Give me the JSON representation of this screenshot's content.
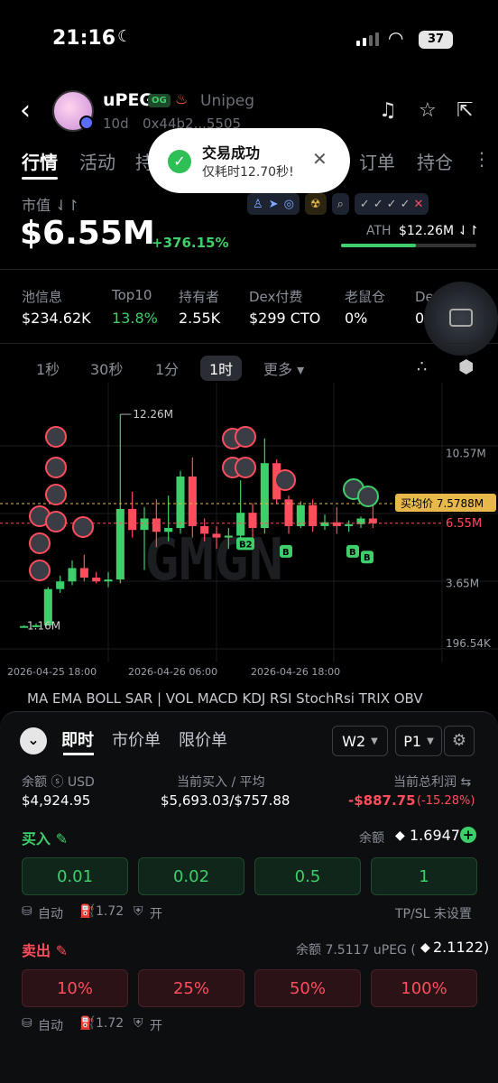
{
  "status_bar": {
    "time": "21:16",
    "battery": "37"
  },
  "header": {
    "token_name": "uPEG",
    "og_badge": "OG",
    "token_full": "Unipeg",
    "age": "10d",
    "address": "0x44b2...5505"
  },
  "tabs": [
    "行情",
    "活动",
    "持",
    "订单",
    "持仓"
  ],
  "toast": {
    "title": "交易成功",
    "subtitle": "仅耗时12.70秒!"
  },
  "market": {
    "label": "市值 ⇃↾",
    "value": "$6.55M",
    "change": "+376.15%",
    "ath_label": "ATH",
    "ath_value": "$12.26M ⇃↾",
    "ath_fraction": 0.55
  },
  "stats": [
    {
      "label": "池信息",
      "value": "$234.62K",
      "color": "#ffffff"
    },
    {
      "label": "Top10",
      "value": "13.8%",
      "color": "#3ecf6a"
    },
    {
      "label": "持有者",
      "value": "2.55K",
      "color": "#ffffff"
    },
    {
      "label": "Dex付费",
      "value": "$299 CTO",
      "color": "#ffffff"
    },
    {
      "label": "老鼠仓",
      "value": "0%",
      "color": "#ffffff"
    },
    {
      "label": "Dev持仓",
      "value": "0%",
      "color": "#ffffff"
    }
  ],
  "timeframes": [
    "1秒",
    "30秒",
    "1分",
    "1时",
    "更多 ▾"
  ],
  "chart_data": {
    "type": "candlestick",
    "y_tick_labels": [
      "10.57M",
      "6.55M",
      "3.65M",
      "196.54K"
    ],
    "high_label": "12.26M",
    "low_label": "1.16M",
    "avg_price_label": "买均价 7.5788M",
    "current_label": "6.55M",
    "x_tick_labels": [
      "2026-04-25 18:00",
      "2026-04-26 06:00",
      "2026-04-26 18:00"
    ],
    "watermark": "GMGN",
    "trade_markers": [
      "B2",
      "B",
      "B",
      "B"
    ],
    "candles": [
      {
        "o": 1.16,
        "h": 1.2,
        "l": 1.1,
        "c": 1.16
      },
      {
        "o": 1.16,
        "h": 1.3,
        "l": 1.1,
        "c": 1.2
      },
      {
        "o": 1.2,
        "h": 3.2,
        "l": 1.2,
        "c": 3.1
      },
      {
        "o": 3.1,
        "h": 3.8,
        "l": 2.9,
        "c": 3.5
      },
      {
        "o": 3.5,
        "h": 4.6,
        "l": 3.3,
        "c": 4.2
      },
      {
        "o": 4.2,
        "h": 4.9,
        "l": 3.5,
        "c": 3.7
      },
      {
        "o": 3.7,
        "h": 4.0,
        "l": 3.4,
        "c": 3.5
      },
      {
        "o": 3.5,
        "h": 4.0,
        "l": 3.2,
        "c": 3.6
      },
      {
        "o": 3.6,
        "h": 12.26,
        "l": 3.4,
        "c": 7.3
      },
      {
        "o": 7.3,
        "h": 8.2,
        "l": 5.8,
        "c": 6.2
      },
      {
        "o": 6.2,
        "h": 7.4,
        "l": 4.1,
        "c": 6.8
      },
      {
        "o": 6.8,
        "h": 7.8,
        "l": 5.3,
        "c": 6.1
      },
      {
        "o": 6.1,
        "h": 8.0,
        "l": 5.6,
        "c": 6.3
      },
      {
        "o": 6.3,
        "h": 9.3,
        "l": 6.0,
        "c": 9.0
      },
      {
        "o": 9.0,
        "h": 10.0,
        "l": 5.8,
        "c": 6.4
      },
      {
        "o": 6.4,
        "h": 6.8,
        "l": 5.6,
        "c": 6.0
      },
      {
        "o": 6.0,
        "h": 6.4,
        "l": 5.2,
        "c": 5.8
      },
      {
        "o": 5.8,
        "h": 6.3,
        "l": 5.2,
        "c": 5.9
      },
      {
        "o": 5.9,
        "h": 8.8,
        "l": 5.6,
        "c": 7.1
      },
      {
        "o": 7.1,
        "h": 7.6,
        "l": 5.8,
        "c": 6.3
      },
      {
        "o": 6.3,
        "h": 11.0,
        "l": 6.0,
        "c": 9.7
      },
      {
        "o": 9.7,
        "h": 9.9,
        "l": 7.6,
        "c": 7.8
      },
      {
        "o": 7.8,
        "h": 8.0,
        "l": 6.0,
        "c": 6.4
      },
      {
        "o": 6.4,
        "h": 7.7,
        "l": 6.3,
        "c": 7.5
      },
      {
        "o": 7.5,
        "h": 7.8,
        "l": 6.1,
        "c": 6.4
      },
      {
        "o": 6.4,
        "h": 7.0,
        "l": 6.2,
        "c": 6.6
      },
      {
        "o": 6.6,
        "h": 7.4,
        "l": 6.0,
        "c": 6.4
      },
      {
        "o": 6.4,
        "h": 6.7,
        "l": 6.1,
        "c": 6.5
      },
      {
        "o": 6.5,
        "h": 6.9,
        "l": 6.3,
        "c": 6.8
      },
      {
        "o": 6.8,
        "h": 7.5,
        "l": 6.3,
        "c": 6.55
      }
    ]
  },
  "indicators": "MA  EMA  BOLL  SAR  |  VOL  MACD  KDJ  RSI  StochRsi  TRIX  OBV",
  "panel": {
    "tabs": [
      "即时",
      "市价单",
      "限价单"
    ],
    "wallet": "W2",
    "preset": "P1",
    "balance_label": "余额 ⓢ USD",
    "balance_value": "$4,924.95",
    "bought_label": "当前买入 / 平均",
    "bought_value": "$5,693.03/$757.88",
    "pnl_label": "当前总利润 ⇆",
    "pnl_value": "-$887.75",
    "pnl_pct": "(-15.28%)",
    "buy": {
      "title": "买入 ✎",
      "balance_label": "余额",
      "balance_value": "1.6947",
      "amounts": [
        "0.01",
        "0.02",
        "0.5",
        "1"
      ],
      "auto": "自动",
      "gas": "1.72",
      "mev": "开",
      "tpsl": "TP/SL 未设置"
    },
    "sell": {
      "title": "卖出 ✎",
      "balance_label": "余额 7.5117 uPEG (",
      "balance_value": "2.1122)",
      "amounts": [
        "10%",
        "25%",
        "50%",
        "100%"
      ],
      "auto": "自动",
      "gas": "1.72",
      "mev": "开"
    }
  }
}
